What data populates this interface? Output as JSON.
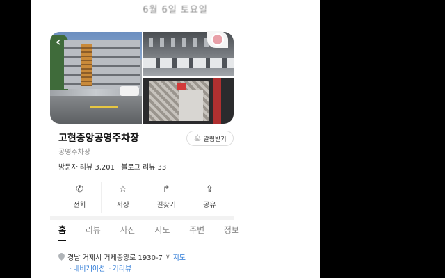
{
  "header": {
    "date_text": "6월 6일 토요일"
  },
  "place": {
    "name": "고현중앙공영주차장",
    "category": "공영주차장",
    "visitor_reviews_label": "방문자 리뷰 3,201",
    "blog_reviews_label": "블로그 리뷰 33",
    "alert_label": "알림받기"
  },
  "icons": {
    "back": "chevron-left-icon",
    "alert": "bell-icon",
    "phone": "phone-icon",
    "save": "star-icon",
    "directions": "direction-arrow-icon",
    "share": "share-icon",
    "location": "map-pin-icon"
  },
  "actions": [
    {
      "label": "전화",
      "icon": "phone-icon"
    },
    {
      "label": "저장",
      "icon": "star-icon"
    },
    {
      "label": "길찾기",
      "icon": "direction-arrow-icon"
    },
    {
      "label": "공유",
      "icon": "share-icon"
    }
  ],
  "tabs": [
    {
      "label": "홈",
      "active": true
    },
    {
      "label": "리뷰",
      "active": false
    },
    {
      "label": "사진",
      "active": false
    },
    {
      "label": "지도",
      "active": false
    },
    {
      "label": "주변",
      "active": false
    },
    {
      "label": "정보",
      "active": false
    }
  ],
  "address": {
    "text": "경남 거제시 거제중앙로 1930-7",
    "map_link": "지도",
    "links": [
      "내비게이션",
      "거리뷰"
    ]
  },
  "colors": {
    "link": "#2a78d6",
    "text": "#111111",
    "muted": "#888888"
  }
}
